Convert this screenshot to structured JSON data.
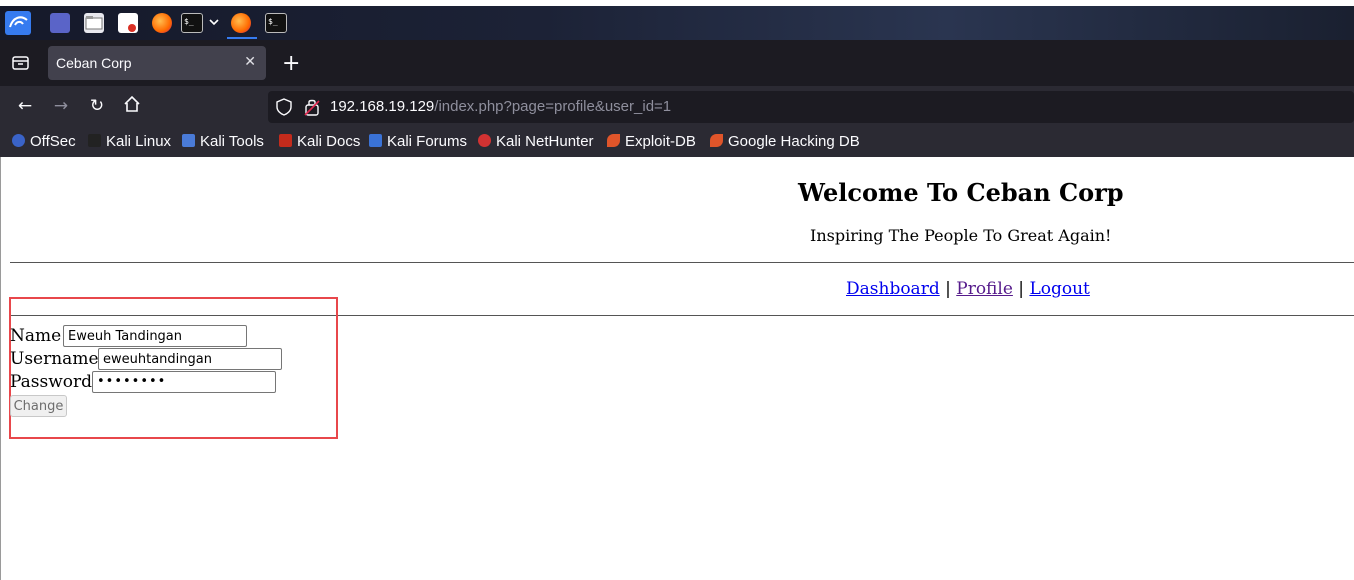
{
  "browser": {
    "tab_title": "Ceban Corp",
    "url_host": "192.168.19.129",
    "url_path": "/index.php?page=profile&user_id=1",
    "bookmarks": [
      "OffSec",
      "Kali Linux",
      "Kali Tools",
      "Kali Docs",
      "Kali Forums",
      "Kali NetHunter",
      "Exploit-DB",
      "Google Hacking DB"
    ]
  },
  "page": {
    "heading": "Welcome To Ceban Corp",
    "tagline": "Inspiring The People To Great Again!",
    "nav": {
      "dashboard": "Dashboard",
      "profile": "Profile",
      "logout": "Logout",
      "separator": "|"
    },
    "form": {
      "name_label": "Name",
      "name_value": "Eweuh Tandingan",
      "username_label": "Username",
      "username_value": "eweuhtandingan",
      "password_label": "Password",
      "password_value": "••••••••",
      "change_button": "Change"
    }
  },
  "colors": {
    "highlight_box": "#e8474b",
    "link": "#0000ee",
    "visited_link": "#551a8b"
  },
  "icons": [
    "kali-menu-icon",
    "workspace-icon",
    "file-manager-icon",
    "text-editor-icon",
    "firefox-icon",
    "terminal-icon",
    "chevron-down-icon",
    "firefox-active-icon",
    "terminal-icon-2",
    "tab-list-icon",
    "close-tab-icon",
    "new-tab-icon",
    "back-icon",
    "forward-icon",
    "reload-icon",
    "home-icon",
    "shield-icon",
    "insecure-lock-icon"
  ]
}
